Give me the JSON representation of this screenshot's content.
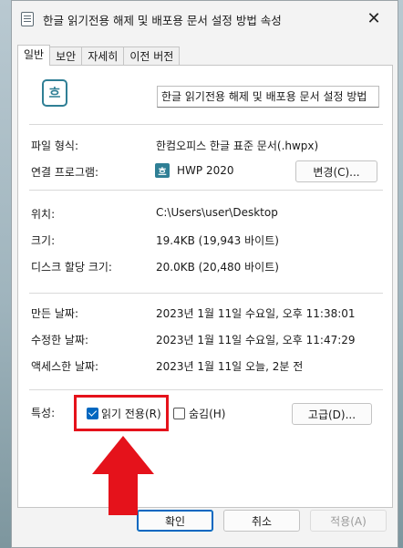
{
  "window": {
    "title": "한글 읽기전용 해제 및 배포용 문서 설정 방법 속성",
    "close_glyph": "✕"
  },
  "tabs": [
    "일반",
    "보안",
    "자세히",
    "이전 버전"
  ],
  "file": {
    "icon_glyph": "흐",
    "name": "한글 읽기전용 해제 및 배포용 문서 설정 방법"
  },
  "rows": {
    "type": {
      "label": "파일 형식:",
      "value": "한컴오피스 한글 표준 문서(.hwpx)"
    },
    "opens_with": {
      "label": "연결 프로그램:",
      "value": "HWP 2020",
      "icon_glyph": "흐",
      "button": "변경(C)..."
    },
    "location": {
      "label": "위치:",
      "value": "C:\\Users\\user\\Desktop"
    },
    "size": {
      "label": "크기:",
      "value": "19.4KB (19,943 바이트)"
    },
    "size_on_disk": {
      "label": "디스크 할당 크기:",
      "value": "20.0KB (20,480 바이트)"
    },
    "created": {
      "label": "만든 날짜:",
      "value": "2023년 1월 11일 수요일, 오후 11:38:01"
    },
    "modified": {
      "label": "수정한 날짜:",
      "value": "2023년 1월 11일 수요일, 오후 11:47:29"
    },
    "accessed": {
      "label": "액세스한 날짜:",
      "value": "2023년 1월 11일 오늘, 2분 전"
    }
  },
  "attributes": {
    "label": "특성:",
    "readonly": {
      "label": "읽기 전용(R)",
      "checked": true
    },
    "hidden": {
      "label": "숨김(H)",
      "checked": false
    },
    "advanced_button": "고급(D)..."
  },
  "footer": {
    "ok": "확인",
    "cancel": "취소",
    "apply": "적용(A)"
  },
  "colors": {
    "highlight": "#e5121b",
    "accent": "#0067c0",
    "hwp_icon": "#2f7f95"
  }
}
